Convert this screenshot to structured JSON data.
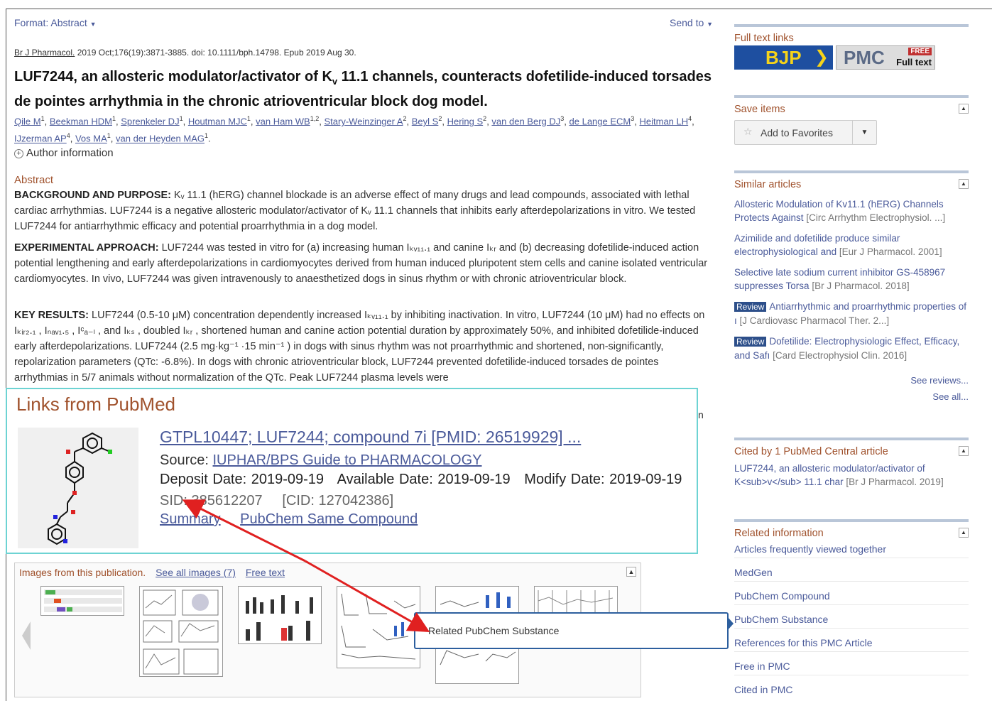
{
  "header": {
    "format_label": "Format:",
    "format_value": "Abstract",
    "send_to": "Send to"
  },
  "citation": {
    "journal": "Br J Pharmacol.",
    "details": "2019 Oct;176(19):3871-3885. doi: 10.1111/bph.14798. Epub 2019 Aug 30."
  },
  "article": {
    "title_part1": "LUF7244, an allosteric modulator/activator of K",
    "title_sub": "v",
    "title_part2": " 11.1 channels, counteracts dofetilide-induced torsades de pointes arrhythmia in the chronic atrioventricular block dog model.",
    "authors": [
      {
        "name": "Qile M",
        "sup": "1"
      },
      {
        "name": "Beekman HDM",
        "sup": "1"
      },
      {
        "name": "Sprenkeler DJ",
        "sup": "1"
      },
      {
        "name": "Houtman MJC",
        "sup": "1"
      },
      {
        "name": "van Ham WB",
        "sup": "1,2"
      },
      {
        "name": "Stary-Weinzinger A",
        "sup": "2"
      },
      {
        "name": "Beyl S",
        "sup": "2"
      },
      {
        "name": "Hering S",
        "sup": "2"
      },
      {
        "name": "van den Berg DJ",
        "sup": "3"
      },
      {
        "name": "de Lange ECM",
        "sup": "3"
      },
      {
        "name": "Heitman LH",
        "sup": "4"
      },
      {
        "name": "IJzerman AP",
        "sup": "4"
      },
      {
        "name": "Vos MA",
        "sup": "1"
      },
      {
        "name": "van der Heyden MAG",
        "sup": "1"
      }
    ],
    "author_info": "Author information"
  },
  "abstract": {
    "heading": "Abstract",
    "background_label": "BACKGROUND AND PURPOSE:",
    "background_text": "Kᵥ 11.1 (hERG) channel blockade is an adverse effect of many drugs and lead compounds, associated with lethal cardiac arrhythmias. LUF7244 is a negative allosteric modulator/activator of Kᵥ 11.1 channels that inhibits early afterdepolarizations in vitro. We tested LUF7244 for antiarrhythmic efficacy and potential proarrhythmia in a dog model.",
    "approach_label": "EXPERIMENTAL APPROACH:",
    "approach_text": "LUF7244 was tested in vitro for (a) increasing human Iₖᵥ₁₁.₁ and canine Iₖᵣ and (b) decreasing dofetilide-induced action potential lengthening and early afterdepolarizations in cardiomyocytes derived from human induced pluripotent stem cells and canine isolated ventricular cardiomyocytes. In vivo, LUF7244 was given intravenously to anaesthetized dogs in sinus rhythm or with chronic atrioventricular block.",
    "results_label": "KEY RESULTS:",
    "results_text": "LUF7244 (0.5-10 μM) concentration dependently increased Iₖᵥ₁₁.₁ by inhibiting inactivation. In vitro, LUF7244 (10 μM) had no effects on Iₖᵢᵣ₂.₁ , Iₙₐᵥ₁.₅ , Iᶜₐ₋ₗ , and Iₖₛ , doubled Iₖᵣ , shortened human and canine action potential duration by approximately 50%, and inhibited dofetilide-induced early afterdepolarizations. LUF7244 (2.5 mg·kg⁻¹ ·15 min⁻¹ ) in dogs with sinus rhythm was not proarrhythmic and shortened, non-significantly, repolarization parameters (QTc: -6.8%). In dogs with chronic atrioventricular block, LUF7244 prevented dofetilide-induced torsades de pointes arrhythmias in 5/7 animals without normalization of the QTc. Peak LUF7244 plasma levels were"
  },
  "links_popup": {
    "title": "Links from PubMed",
    "record_title": "GTPL10447; LUF7244; compound 7i [PMID: 26519929] ...",
    "source_label": "Source:",
    "source_value": "IUPHAR/BPS Guide to PHARMACOLOGY",
    "dates": "Deposit Date: 2019-09-19   Available Date: 2019-09-19   Modify Date: 2019-09-19",
    "sid": "SID: 385612207     [CID: 127042386]",
    "summary": "Summary",
    "same_compound": "PubChem Same Compound",
    "trailing_char": "n"
  },
  "images_strip": {
    "title": "Images from this publication.",
    "see_all": "See all images (7)",
    "free_text": "Free text"
  },
  "tooltip": {
    "text": "Related PubChem Substance"
  },
  "sidebar": {
    "full_text": {
      "title": "Full text links",
      "bjp": "BJP",
      "pmc": "PMC",
      "free": "FREE",
      "full_text": "Full text"
    },
    "save": {
      "title": "Save items",
      "add_favorites": "Add to Favorites"
    },
    "similar": {
      "title": "Similar articles",
      "items": [
        {
          "review": "",
          "text": "Allosteric Modulation of Kv11.1 (hERG) Channels Protects Against",
          "src": "[Circ Arrhythm Electrophysiol. ...]"
        },
        {
          "review": "",
          "text": "Azimilide and dofetilide produce similar electrophysiological and",
          "src": "[Eur J Pharmacol. 2001]"
        },
        {
          "review": "",
          "text": "Selective late sodium current inhibitor GS-458967 suppresses Torsa",
          "src": "[Br J Pharmacol. 2018]"
        },
        {
          "review": "Review",
          "text": "Antiarrhythmic and proarrhythmic properties of ı",
          "src": "[J Cardiovasc Pharmacol Ther. 2...]"
        },
        {
          "review": "Review",
          "text": "Dofetilide: Electrophysiologic Effect, Efficacy, and Safı",
          "src": "[Card Electrophysiol Clin. 2016]"
        }
      ],
      "see_reviews": "See reviews...",
      "see_all": "See all..."
    },
    "cited": {
      "title": "Cited by 1 PubMed Central article",
      "item_text": "LUF7244, an allosteric modulator/activator of K<sub>v</sub> 11.1 char",
      "item_src": "[Br J Pharmacol. 2019]"
    },
    "related": {
      "title": "Related information",
      "items": [
        "Articles frequently viewed together",
        "MedGen",
        "PubChem Compound",
        "PubChem Substance",
        "References for this PMC Article",
        "Free in PMC",
        "Cited in PMC"
      ]
    }
  },
  "colors": {
    "link": "#4a5a9a",
    "heading": "#a0522d",
    "popup_border": "#6dd3d3",
    "tooltip_border": "#2d5f9e",
    "arrow": "#e02020"
  }
}
